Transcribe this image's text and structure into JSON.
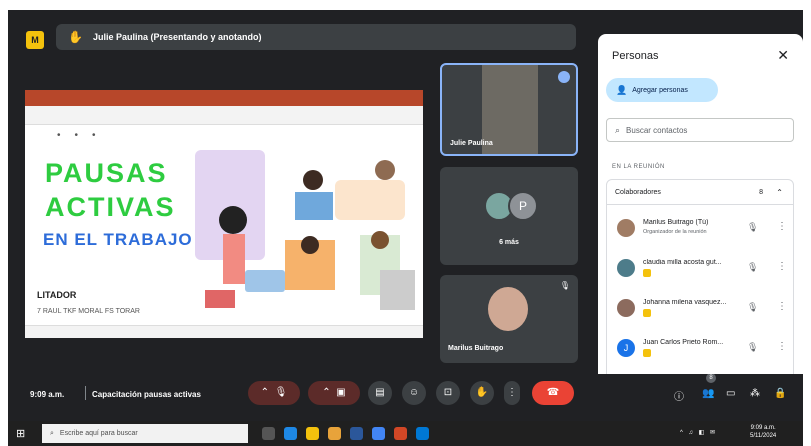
{
  "app": {
    "presenting_label": "Julie Paulina (Presentando y anotando)"
  },
  "slide": {
    "title_line1": "PAUSAS",
    "title_line2": "ACTIVAS",
    "title_line3": "EN EL TRABAJO",
    "text_line4": "LITADOR",
    "text_line5": "7 RAUL TKF MORAL FS TORAR"
  },
  "tiles": [
    {
      "name": "Julie Paulina"
    },
    {
      "count_label": "6 más",
      "avatar_letter": "P"
    },
    {
      "name": "Marilus Buitrago"
    }
  ],
  "controls": {
    "time": "9:09 a.m.",
    "meeting_title": "Capacitación pausas activas",
    "people_badge": "8"
  },
  "panel": {
    "title": "Personas",
    "add_people": "Agregar personas",
    "search_placeholder": "Buscar contactos",
    "section": "EN LA REUNIÓN",
    "group_label": "Colaboradores",
    "group_count": "8",
    "participants": [
      {
        "name": "Marilus Buitrago (Tú)",
        "subtitle": "Organizador de la reunión",
        "color": "#a07c64"
      },
      {
        "name": "claudia milla acosta gut...",
        "subtitle": "",
        "color": "#4d7c8a"
      },
      {
        "name": "Johanna milena vasquez...",
        "subtitle": "",
        "color": "#8c6b5e"
      },
      {
        "name": "Juan Carlos Prieto Rom...",
        "subtitle": "",
        "color": "#1a73e8",
        "letter": "J"
      }
    ]
  },
  "taskbar": {
    "search_placeholder": "Escribe aquí para buscar",
    "clock_time": "9:09 a.m.",
    "clock_date": "5/11/2024"
  }
}
